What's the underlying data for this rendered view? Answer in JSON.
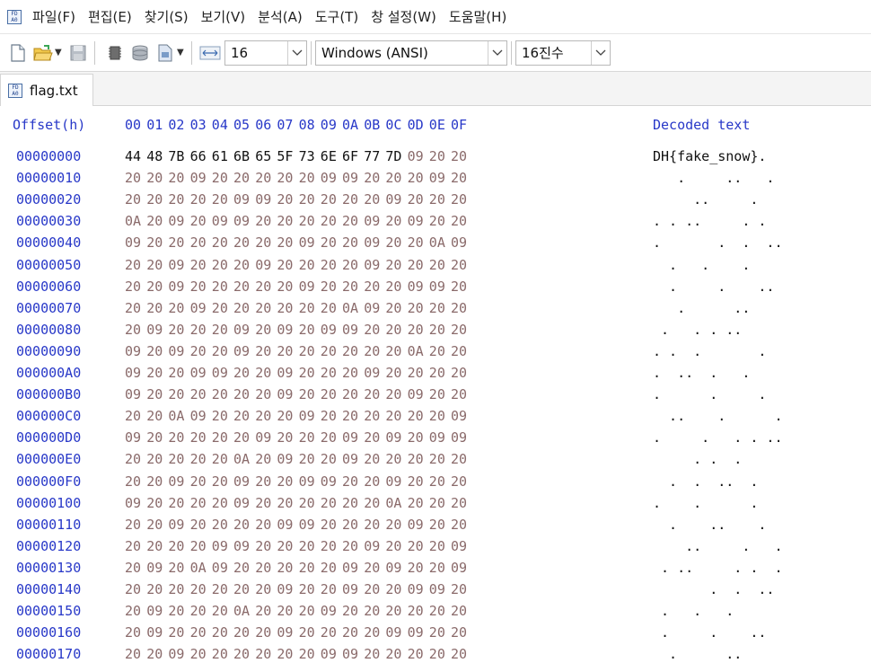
{
  "menu": {
    "items": [
      "파일(F)",
      "편집(E)",
      "찾기(S)",
      "보기(V)",
      "분석(A)",
      "도구(T)",
      "창 설정(W)",
      "도움말(H)"
    ]
  },
  "toolbar": {
    "bytes_per_row": "16",
    "encoding": "Windows (ANSI)",
    "number_base": "16진수"
  },
  "tab": {
    "label": "flag.txt"
  },
  "hex": {
    "offset_header": "Offset(h)",
    "column_headers": [
      "00",
      "01",
      "02",
      "03",
      "04",
      "05",
      "06",
      "07",
      "08",
      "09",
      "0A",
      "0B",
      "0C",
      "0D",
      "0E",
      "0F"
    ],
    "decoded_header": "Decoded text",
    "rows": [
      {
        "offset": "00000000",
        "bytes": [
          "44",
          "48",
          "7B",
          "66",
          "61",
          "6B",
          "65",
          "5F",
          "73",
          "6E",
          "6F",
          "77",
          "7D",
          "09",
          "20",
          "20"
        ],
        "text": "DH{fake_snow}.  "
      },
      {
        "offset": "00000010",
        "bytes": [
          "20",
          "20",
          "20",
          "09",
          "20",
          "20",
          "20",
          "20",
          "20",
          "09",
          "09",
          "20",
          "20",
          "20",
          "09",
          "20"
        ],
        "text": "   .     ..   . "
      },
      {
        "offset": "00000020",
        "bytes": [
          "20",
          "20",
          "20",
          "20",
          "20",
          "09",
          "09",
          "20",
          "20",
          "20",
          "20",
          "20",
          "09",
          "20",
          "20",
          "20"
        ],
        "text": "     ..     .   "
      },
      {
        "offset": "00000030",
        "bytes": [
          "0A",
          "20",
          "09",
          "20",
          "09",
          "09",
          "20",
          "20",
          "20",
          "20",
          "20",
          "09",
          "20",
          "09",
          "20",
          "20"
        ],
        "text": ". . ..     . .  "
      },
      {
        "offset": "00000040",
        "bytes": [
          "09",
          "20",
          "20",
          "20",
          "20",
          "20",
          "20",
          "20",
          "09",
          "20",
          "20",
          "09",
          "20",
          "20",
          "0A",
          "09"
        ],
        "text": ".       .  .  .."
      },
      {
        "offset": "00000050",
        "bytes": [
          "20",
          "20",
          "09",
          "20",
          "20",
          "20",
          "09",
          "20",
          "20",
          "20",
          "20",
          "09",
          "20",
          "20",
          "20",
          "20"
        ],
        "text": "  .   .    .    "
      },
      {
        "offset": "00000060",
        "bytes": [
          "20",
          "20",
          "09",
          "20",
          "20",
          "20",
          "20",
          "20",
          "09",
          "20",
          "20",
          "20",
          "20",
          "09",
          "09",
          "20"
        ],
        "text": "  .     .    .. "
      },
      {
        "offset": "00000070",
        "bytes": [
          "20",
          "20",
          "20",
          "09",
          "20",
          "20",
          "20",
          "20",
          "20",
          "20",
          "0A",
          "09",
          "20",
          "20",
          "20",
          "20"
        ],
        "text": "   .      ..    "
      },
      {
        "offset": "00000080",
        "bytes": [
          "20",
          "09",
          "20",
          "20",
          "20",
          "09",
          "20",
          "09",
          "20",
          "09",
          "09",
          "20",
          "20",
          "20",
          "20",
          "20"
        ],
        "text": " .   . . ..     "
      },
      {
        "offset": "00000090",
        "bytes": [
          "09",
          "20",
          "09",
          "20",
          "20",
          "09",
          "20",
          "20",
          "20",
          "20",
          "20",
          "20",
          "20",
          "0A",
          "20",
          "20"
        ],
        "text": ". .  .       .  "
      },
      {
        "offset": "000000A0",
        "bytes": [
          "09",
          "20",
          "20",
          "09",
          "09",
          "20",
          "20",
          "09",
          "20",
          "20",
          "20",
          "09",
          "20",
          "20",
          "20",
          "20"
        ],
        "text": ".  ..  .   .    "
      },
      {
        "offset": "000000B0",
        "bytes": [
          "09",
          "20",
          "20",
          "20",
          "20",
          "20",
          "20",
          "09",
          "20",
          "20",
          "20",
          "20",
          "20",
          "09",
          "20",
          "20"
        ],
        "text": ".      .     .  "
      },
      {
        "offset": "000000C0",
        "bytes": [
          "20",
          "20",
          "0A",
          "09",
          "20",
          "20",
          "20",
          "20",
          "09",
          "20",
          "20",
          "20",
          "20",
          "20",
          "20",
          "09"
        ],
        "text": "  ..    .      ."
      },
      {
        "offset": "000000D0",
        "bytes": [
          "09",
          "20",
          "20",
          "20",
          "20",
          "20",
          "09",
          "20",
          "20",
          "20",
          "09",
          "20",
          "09",
          "20",
          "09",
          "09"
        ],
        "text": ".     .   . . .."
      },
      {
        "offset": "000000E0",
        "bytes": [
          "20",
          "20",
          "20",
          "20",
          "20",
          "0A",
          "20",
          "09",
          "20",
          "20",
          "09",
          "20",
          "20",
          "20",
          "20",
          "20"
        ],
        "text": "     . .  .     "
      },
      {
        "offset": "000000F0",
        "bytes": [
          "20",
          "20",
          "09",
          "20",
          "20",
          "09",
          "20",
          "20",
          "09",
          "09",
          "20",
          "20",
          "09",
          "20",
          "20",
          "20"
        ],
        "text": "  .  .  ..  .   "
      },
      {
        "offset": "00000100",
        "bytes": [
          "09",
          "20",
          "20",
          "20",
          "20",
          "09",
          "20",
          "20",
          "20",
          "20",
          "20",
          "20",
          "0A",
          "20",
          "20",
          "20"
        ],
        "text": ".    .      .   "
      },
      {
        "offset": "00000110",
        "bytes": [
          "20",
          "20",
          "09",
          "20",
          "20",
          "20",
          "20",
          "09",
          "09",
          "20",
          "20",
          "20",
          "20",
          "09",
          "20",
          "20"
        ],
        "text": "  .    ..    .  "
      },
      {
        "offset": "00000120",
        "bytes": [
          "20",
          "20",
          "20",
          "20",
          "09",
          "09",
          "20",
          "20",
          "20",
          "20",
          "20",
          "09",
          "20",
          "20",
          "20",
          "09"
        ],
        "text": "    ..     .   ."
      },
      {
        "offset": "00000130",
        "bytes": [
          "20",
          "09",
          "20",
          "0A",
          "09",
          "20",
          "20",
          "20",
          "20",
          "20",
          "09",
          "20",
          "09",
          "20",
          "20",
          "09"
        ],
        "text": " . ..     . .  ."
      },
      {
        "offset": "00000140",
        "bytes": [
          "20",
          "20",
          "20",
          "20",
          "20",
          "20",
          "20",
          "09",
          "20",
          "20",
          "09",
          "20",
          "20",
          "09",
          "09",
          "20"
        ],
        "text": "       .  .  .. "
      },
      {
        "offset": "00000150",
        "bytes": [
          "20",
          "09",
          "20",
          "20",
          "20",
          "0A",
          "20",
          "20",
          "20",
          "09",
          "20",
          "20",
          "20",
          "20",
          "20",
          "20"
        ],
        "text": " .   .   .      "
      },
      {
        "offset": "00000160",
        "bytes": [
          "20",
          "09",
          "20",
          "20",
          "20",
          "20",
          "20",
          "09",
          "20",
          "20",
          "20",
          "20",
          "09",
          "09",
          "20",
          "20"
        ],
        "text": " .     .    ..  "
      },
      {
        "offset": "00000170",
        "bytes": [
          "20",
          "20",
          "09",
          "20",
          "20",
          "20",
          "20",
          "20",
          "20",
          "09",
          "09",
          "20",
          "20",
          "20",
          "20",
          "20"
        ],
        "text": "  .      ..     "
      }
    ]
  }
}
